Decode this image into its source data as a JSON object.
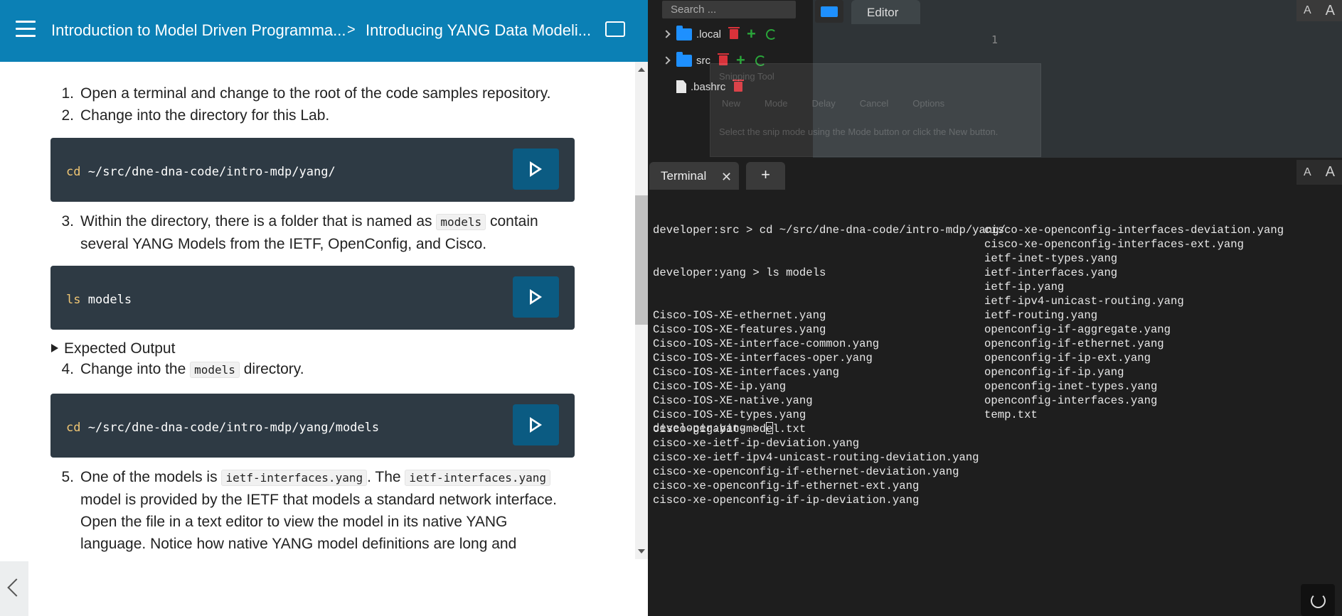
{
  "header": {
    "crumb1": "Introduction to Model Driven Programma...",
    "sep": ">",
    "crumb2": "Introducing YANG Data Modeli..."
  },
  "content": {
    "step1": {
      "num": "1.",
      "text": "Open a terminal and change to the root of the code samples repository."
    },
    "step2": {
      "num": "2.",
      "text": "Change into the directory for this Lab."
    },
    "code1": {
      "kw": "cd",
      "rest": " ~/src/dne-dna-code/intro-mdp/yang/"
    },
    "step3": {
      "num": "3.",
      "pre": "Within the directory, there is a folder that is named as ",
      "code": "models",
      "post": " contain several YANG Models from the IETF, OpenConfig, and Cisco."
    },
    "code2": {
      "kw": "ls",
      "rest": " models"
    },
    "expected": "Expected Output",
    "step4": {
      "num": "4.",
      "pre": "Change into the ",
      "code": "models",
      "post": " directory."
    },
    "code3": {
      "kw": "cd",
      "rest": " ~/src/dne-dna-code/intro-mdp/yang/models"
    },
    "step5": {
      "num": "5.",
      "pre": "One of the models is ",
      "code1": "ietf-interfaces.yang",
      "mid": ". The ",
      "code2": "ietf-interfaces.yang",
      "post": " model is provided by the IETF that models a standard network interface. Open the file in a text editor to view the model in its native YANG language. Notice how native YANG model definitions are long and descriptive (as you'd expect and want). As a consumer of YANG models,"
    }
  },
  "filetree": {
    "search_placeholder": "Search ...",
    "items": [
      {
        "name": ".local"
      },
      {
        "name": "src"
      },
      {
        "name": ".bashrc"
      }
    ]
  },
  "editor": {
    "tab": "Editor",
    "line1": "1",
    "font_small": "A",
    "font_big": "A"
  },
  "snipping_tool": {
    "title": "Snipping Tool",
    "new": "New",
    "mode": "Mode",
    "delay": "Delay",
    "cancel": "Cancel",
    "options": "Options",
    "hint": "Select the snip mode using the Mode button or click the New button."
  },
  "terminal": {
    "tab": "Terminal",
    "close": "✕",
    "add": "+",
    "font_small": "A",
    "font_big": "A",
    "line1": "developer:src > cd ~/src/dne-dna-code/intro-mdp/yang/",
    "line2": "developer:yang > ls models",
    "col1": [
      "Cisco-IOS-XE-ethernet.yang",
      "Cisco-IOS-XE-features.yang",
      "Cisco-IOS-XE-interface-common.yang",
      "Cisco-IOS-XE-interfaces-oper.yang",
      "Cisco-IOS-XE-interfaces.yang",
      "Cisco-IOS-XE-ip.yang",
      "Cisco-IOS-XE-native.yang",
      "Cisco-IOS-XE-types.yang",
      "cisco-gigabit-model.txt",
      "cisco-xe-ietf-ip-deviation.yang",
      "cisco-xe-ietf-ipv4-unicast-routing-deviation.yang",
      "cisco-xe-openconfig-if-ethernet-deviation.yang",
      "cisco-xe-openconfig-if-ethernet-ext.yang",
      "cisco-xe-openconfig-if-ip-deviation.yang"
    ],
    "col2": [
      "cisco-xe-openconfig-interfaces-deviation.yang",
      "cisco-xe-openconfig-interfaces-ext.yang",
      "ietf-inet-types.yang",
      "ietf-interfaces.yang",
      "ietf-ip.yang",
      "ietf-ipv4-unicast-routing.yang",
      "ietf-routing.yang",
      "openconfig-if-aggregate.yang",
      "openconfig-if-ethernet.yang",
      "openconfig-if-ip-ext.yang",
      "openconfig-if-ip.yang",
      "openconfig-inet-types.yang",
      "openconfig-interfaces.yang",
      "temp.txt"
    ],
    "prompt": "developer:yang > "
  }
}
